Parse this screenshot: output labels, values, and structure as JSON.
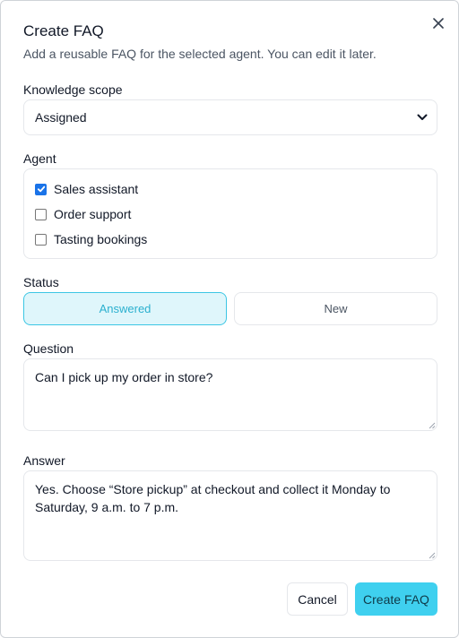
{
  "dialog": {
    "title": "Create FAQ",
    "subtitle": "Add a reusable FAQ for the selected agent. You can edit it later.",
    "close_icon": "close-icon"
  },
  "scope": {
    "label": "Knowledge scope",
    "selected": "Assigned"
  },
  "agent": {
    "label": "Agent",
    "items": [
      {
        "label": "Sales assistant",
        "checked": true
      },
      {
        "label": "Order support",
        "checked": false
      },
      {
        "label": "Tasting bookings",
        "checked": false
      }
    ]
  },
  "status": {
    "label": "Status",
    "options": [
      {
        "label": "Answered",
        "selected": true
      },
      {
        "label": "New",
        "selected": false
      }
    ]
  },
  "question": {
    "label": "Question",
    "value": "Can I pick up my order in store?"
  },
  "answer": {
    "label": "Answer",
    "value": "Yes. Choose “Store pickup” at checkout and collect it Monday to Saturday, 9 a.m. to 7 p.m."
  },
  "actions": {
    "cancel": "Cancel",
    "create": "Create FAQ"
  },
  "colors": {
    "accent": "#3fd0ef",
    "accent_light": "#dff6fb",
    "accent_text": "#2bb0cf",
    "checkbox": "#1a73e8"
  }
}
